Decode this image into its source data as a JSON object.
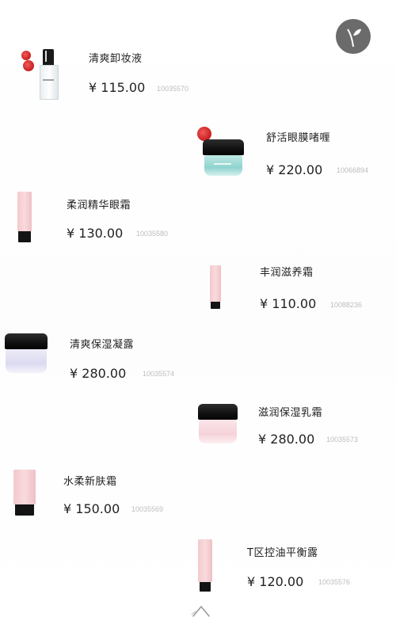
{
  "currency_symbol": "¥",
  "brand_icon": "leaf-logo-icon",
  "products": [
    {
      "name": "清爽卸妆液",
      "price": "¥ 115.00",
      "code": "10035570",
      "badge_color": "#d42a2a"
    },
    {
      "name": "舒活眼膜啫喱",
      "price": "¥ 220.00",
      "code": "10066894",
      "badge_color": "#d42a2a"
    },
    {
      "name": "柔润精华眼霜",
      "price": "¥ 130.00",
      "code": "10035580"
    },
    {
      "name": "丰润滋养霜",
      "price": "¥ 110.00",
      "code": "10088236"
    },
    {
      "name": "清爽保湿凝露",
      "price": "¥ 280.00",
      "code": "10035574"
    },
    {
      "name": "滋润保湿乳霜",
      "price": "¥ 280.00",
      "code": "10035573"
    },
    {
      "name": "水柔新肤霜",
      "price": "¥ 150.00",
      "code": "10035569"
    },
    {
      "name": "T区控油平衡露",
      "price": "¥ 120.00",
      "code": "10035576"
    }
  ],
  "scroll_hint_icon": "swipe-up-icon",
  "colors": {
    "text": "#222222",
    "code": "#bdbdbd",
    "badge": "#d42a2a",
    "logo_bg": "#6b6b6b"
  }
}
